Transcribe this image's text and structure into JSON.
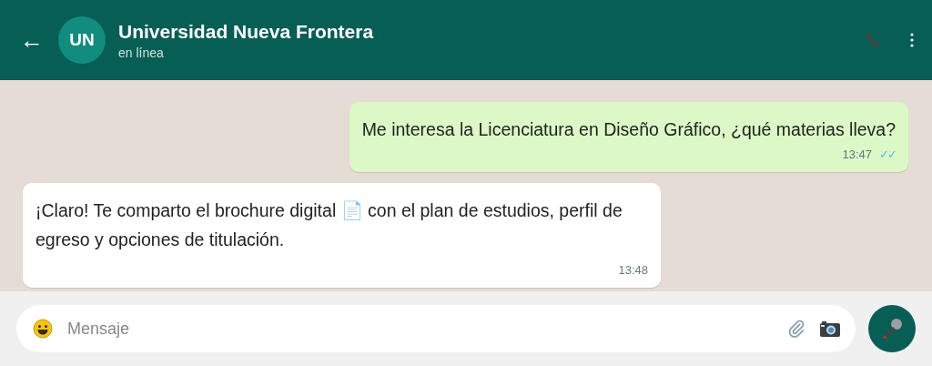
{
  "header": {
    "back": "←",
    "avatar": "UN",
    "title": "Universidad Nueva Frontera",
    "status": "en línea"
  },
  "messages": [
    {
      "kind": "out",
      "text": "Me interesa la Licenciatura en Diseño Gráfico, ¿qué materias lleva?",
      "time": "13:47",
      "ticks": "✓✓",
      "read": true
    },
    {
      "kind": "in",
      "text": "¡Claro! Te comparto el brochure digital 📄 con el plan de estudios, perfil de egreso y opciones de titulación.",
      "time": "13:48"
    }
  ],
  "composer": {
    "placeholder": "Mensaje"
  }
}
